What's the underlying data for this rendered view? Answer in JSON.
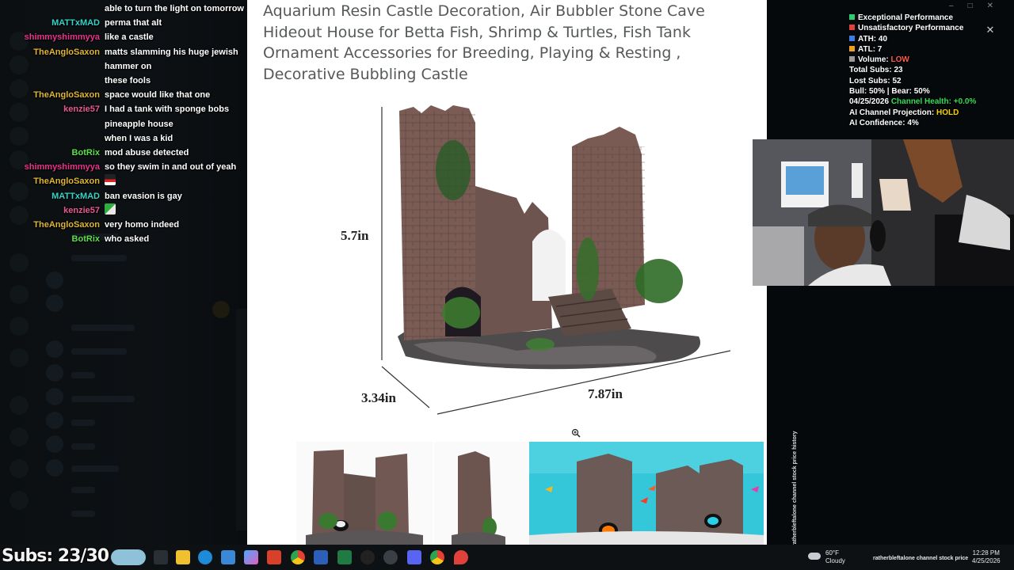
{
  "chat": {
    "messages": [
      {
        "user": "",
        "user_color": "#ffffff",
        "text": "able to turn the light on tomorrow"
      },
      {
        "user": "MATTxMAD",
        "user_color": "#35d3c8",
        "text": "perma that alt"
      },
      {
        "user": "shimmyshimmyya",
        "user_color": "#e8348a",
        "text": "like a castle"
      },
      {
        "user": "TheAngloSaxon",
        "user_color": "#e0b530",
        "text": "matts slamming his huge jewish hammer on\nthese fools"
      },
      {
        "user": "TheAngloSaxon",
        "user_color": "#e0b530",
        "text": "space would like that one"
      },
      {
        "user": "kenzie57",
        "user_color": "#e85a8c",
        "text": "I had a tank with sponge bobs pineapple house\nwhen I was a kid"
      },
      {
        "user": "BotRix",
        "user_color": "#5be04a",
        "text": "mod abuse detected"
      },
      {
        "user": "shimmyshimmyya",
        "user_color": "#e8348a",
        "text": "so they swim in and out of yeah"
      },
      {
        "user": "TheAngloSaxon",
        "user_color": "#e0b530",
        "text": "",
        "emote": "red"
      },
      {
        "user": "MATTxMAD",
        "user_color": "#35d3c8",
        "text": "ban evasion is gay"
      },
      {
        "user": "kenzie57",
        "user_color": "#e85a8c",
        "text": "",
        "emote": "green"
      },
      {
        "user": "TheAngloSaxon",
        "user_color": "#e0b530",
        "text": "very homo indeed"
      },
      {
        "user": "BotRix",
        "user_color": "#5be04a",
        "text": "who asked"
      }
    ]
  },
  "product": {
    "title": "Aquarium Resin Castle Decoration, Air Bubbler Stone Cave Hideout House for Betta Fish, Shrimp & Turtles, Fish Tank Ornament Accessories for Breeding, Playing & Resting , Decorative Bubbling Castle",
    "dim_height": "5.7in",
    "dim_depth": "3.34in",
    "dim_width": "7.87in"
  },
  "stats": {
    "legend_exceptional": "Exceptional Performance",
    "legend_unsatisfactory": "Unsatisfactory Performance",
    "ath": "ATH: 40",
    "atl": "ATL: 7",
    "volume_label": "Volume: ",
    "volume_value": "LOW",
    "total_subs": "Total Subs: 23",
    "lost_subs": "Lost Subs: 52",
    "bull_bear": "Bull: 50% | Bear: 50%",
    "date": "04/25/2026 ",
    "health_label": "Channel Health: +0.0%",
    "projection_label": "AI Channel Projection: ",
    "projection_value": "HOLD",
    "confidence": "AI Confidence: 4%",
    "colors": {
      "green": "#2ecc71",
      "red": "#e0413a",
      "blue": "#3b7ee8",
      "orange": "#f0a020",
      "gray": "#9a9a9a",
      "low": "#ff5a4a",
      "hold": "#f5d000",
      "health": "#33dd55"
    }
  },
  "vertical_label": "ratherbleftalone channel stock price history",
  "subs_counter": "Subs: 23/30",
  "taskbar": {
    "weather_temp": "60°F",
    "weather_desc": "Cloudy",
    "tray_label": "ratherbleftalone channel stock price",
    "time": "12:28 PM",
    "date": "4/25/2026"
  }
}
